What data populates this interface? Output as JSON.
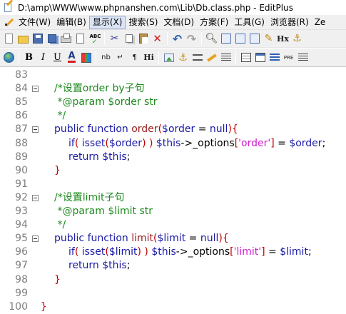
{
  "window": {
    "title": "D:\\amp\\WWW\\www.phpnanshen.com\\Lib\\Db.class.php - EditPlus"
  },
  "menu": {
    "items": [
      {
        "label": "文件(W)"
      },
      {
        "label": "编辑(B)"
      },
      {
        "label": "显示(X)",
        "active": true
      },
      {
        "label": "搜索(S)"
      },
      {
        "label": "文档(D)"
      },
      {
        "label": "方案(F)"
      },
      {
        "label": "工具(G)"
      },
      {
        "label": "浏览器(R)"
      },
      {
        "label": "Ze"
      }
    ]
  },
  "toolbar1": {
    "icons": [
      "new-file-icon",
      "open-file-icon",
      "save-icon",
      "save-all-icon",
      "print-icon",
      "print-preview-icon",
      "spell-check-icon",
      "cut-icon",
      "copy-icon",
      "paste-icon",
      "delete-icon",
      "undo-icon",
      "redo-icon",
      "find-icon",
      "find-in-files-icon",
      "replace-icon",
      "toggle-view-icon",
      "html-toolbar-icon",
      "heading-icon",
      "anchor-icon"
    ],
    "hx_label": "Hx"
  },
  "toolbar2": {
    "icons": [
      "browser-preview-icon",
      "bold-icon",
      "italic-icon",
      "underline-icon",
      "font-color-icon",
      "color-grid-icon",
      "nbsp-icon",
      "line-break-icon",
      "paragraph-icon",
      "heading-icon",
      "image-icon",
      "anchor-icon",
      "horizontal-rule-icon",
      "comment-icon",
      "table-icon",
      "form-icon",
      "list-icon",
      "pre-icon",
      "list-items-icon"
    ],
    "labels": {
      "bold": "B",
      "italic": "I",
      "underline": "U",
      "font_color": "A",
      "nbsp": "nb",
      "line_break": "↵",
      "paragraph": "¶",
      "heading": "Hi",
      "pre": "PRE"
    }
  },
  "editor": {
    "lines": [
      {
        "num": "83",
        "fold": false,
        "indent": 0,
        "tokens": []
      },
      {
        "num": "84",
        "fold": true,
        "indent": 1,
        "tokens": [
          {
            "t": "cm",
            "v": "/*设置order by子句"
          }
        ]
      },
      {
        "num": "85",
        "fold": false,
        "indent": 1,
        "tokens": [
          {
            "t": "cm",
            "v": " *@param $order str"
          }
        ]
      },
      {
        "num": "86",
        "fold": false,
        "indent": 1,
        "tokens": [
          {
            "t": "cm",
            "v": " */"
          }
        ]
      },
      {
        "num": "87",
        "fold": true,
        "indent": 1,
        "tokens": [
          {
            "t": "kw",
            "v": "public function "
          },
          {
            "t": "fn",
            "v": "order"
          },
          {
            "t": "br",
            "v": "("
          },
          {
            "t": "vr",
            "v": "$order"
          },
          {
            "t": "pl",
            "v": " = "
          },
          {
            "t": "kw",
            "v": "null"
          },
          {
            "t": "br",
            "v": "){"
          }
        ]
      },
      {
        "num": "88",
        "fold": false,
        "indent": 2,
        "tokens": [
          {
            "t": "kw",
            "v": "if"
          },
          {
            "t": "br",
            "v": "( "
          },
          {
            "t": "kw",
            "v": "isset"
          },
          {
            "t": "br",
            "v": "("
          },
          {
            "t": "vr",
            "v": "$order"
          },
          {
            "t": "br",
            "v": ") ) "
          },
          {
            "t": "vr",
            "v": "$this"
          },
          {
            "t": "pl",
            "v": "->_options"
          },
          {
            "t": "br",
            "v": "["
          },
          {
            "t": "st",
            "v": "'order'"
          },
          {
            "t": "br",
            "v": "]"
          },
          {
            "t": "pl",
            "v": " = "
          },
          {
            "t": "vr",
            "v": "$order"
          },
          {
            "t": "pl",
            "v": ";"
          }
        ]
      },
      {
        "num": "89",
        "fold": false,
        "indent": 2,
        "tokens": [
          {
            "t": "kw",
            "v": "return "
          },
          {
            "t": "vr",
            "v": "$this"
          },
          {
            "t": "pl",
            "v": ";"
          }
        ]
      },
      {
        "num": "90",
        "fold": false,
        "indent": 1,
        "tokens": [
          {
            "t": "br",
            "v": "}"
          }
        ]
      },
      {
        "num": "91",
        "fold": false,
        "indent": 0,
        "tokens": []
      },
      {
        "num": "92",
        "fold": true,
        "indent": 1,
        "tokens": [
          {
            "t": "cm",
            "v": "/*设置limit子句"
          }
        ]
      },
      {
        "num": "93",
        "fold": false,
        "indent": 1,
        "tokens": [
          {
            "t": "cm",
            "v": " *@param $limit str"
          }
        ]
      },
      {
        "num": "94",
        "fold": false,
        "indent": 1,
        "tokens": [
          {
            "t": "cm",
            "v": " */"
          }
        ]
      },
      {
        "num": "95",
        "fold": true,
        "indent": 1,
        "tokens": [
          {
            "t": "kw",
            "v": "public function "
          },
          {
            "t": "fn",
            "v": "limit"
          },
          {
            "t": "br",
            "v": "("
          },
          {
            "t": "vr",
            "v": "$limit"
          },
          {
            "t": "pl",
            "v": " = "
          },
          {
            "t": "kw",
            "v": "null"
          },
          {
            "t": "br",
            "v": "){"
          }
        ]
      },
      {
        "num": "96",
        "fold": false,
        "indent": 2,
        "tokens": [
          {
            "t": "kw",
            "v": "if"
          },
          {
            "t": "br",
            "v": "( "
          },
          {
            "t": "kw",
            "v": "isset"
          },
          {
            "t": "br",
            "v": "("
          },
          {
            "t": "vr",
            "v": "$limit"
          },
          {
            "t": "br",
            "v": ") ) "
          },
          {
            "t": "vr",
            "v": "$this"
          },
          {
            "t": "pl",
            "v": "->_options"
          },
          {
            "t": "br",
            "v": "["
          },
          {
            "t": "st",
            "v": "'limit'"
          },
          {
            "t": "br",
            "v": "]"
          },
          {
            "t": "pl",
            "v": " = "
          },
          {
            "t": "vr",
            "v": "$limit"
          },
          {
            "t": "pl",
            "v": ";"
          }
        ]
      },
      {
        "num": "97",
        "fold": false,
        "indent": 2,
        "tokens": [
          {
            "t": "kw",
            "v": "return "
          },
          {
            "t": "vr",
            "v": "$this"
          },
          {
            "t": "pl",
            "v": ";"
          }
        ]
      },
      {
        "num": "98",
        "fold": false,
        "indent": 1,
        "tokens": [
          {
            "t": "br",
            "v": "}"
          }
        ]
      },
      {
        "num": "99",
        "fold": false,
        "indent": 0,
        "tokens": []
      },
      {
        "num": "100",
        "fold": false,
        "indent": 0,
        "tokens": [
          {
            "t": "br",
            "v": "}"
          }
        ]
      }
    ]
  },
  "colors": {
    "keyword": "#1a1aa6",
    "comment": "#1e8a1e",
    "string": "#d020d0",
    "bracket": "#c00000",
    "line_number": "#808080"
  }
}
